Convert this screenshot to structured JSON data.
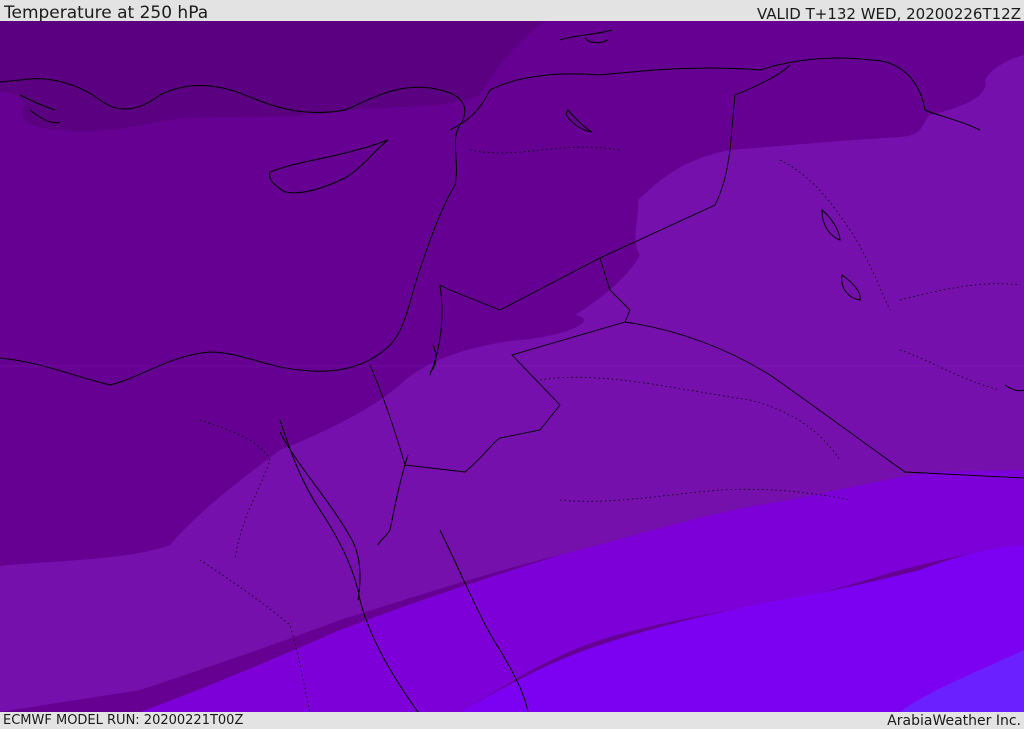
{
  "header": {
    "title": "Temperature at 250 hPa",
    "valid": "VALID T+132 WED, 20200226T12Z"
  },
  "footer": {
    "model_run": "ECMWF MODEL RUN: 20200221T00Z",
    "credit": "ArabiaWeather Inc."
  },
  "colors": {
    "band_coldest": "#5a0080",
    "band_2": "#650092",
    "band_3": "#7510ad",
    "band_4": "#7e00d8",
    "band_5": "#7c00f2",
    "band_warmest": "#6a20ff",
    "border": "#000000",
    "bar_bg": "#e3e3e3"
  }
}
